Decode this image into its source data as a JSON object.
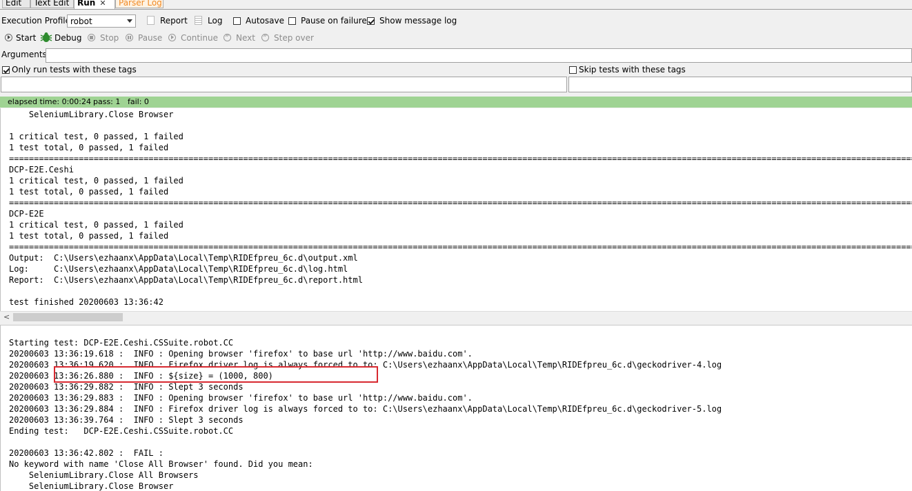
{
  "tabs": [
    {
      "label": "Edit",
      "active": false
    },
    {
      "label": "Text Edit",
      "active": false
    },
    {
      "label": "Run",
      "active": true
    },
    {
      "label": "Parser Log",
      "active": false
    }
  ],
  "tab_close": "✕",
  "profile": {
    "label": "Execution Profile:",
    "value": "robot"
  },
  "report_label": "Report",
  "log_label": "Log",
  "autosave": {
    "label": "Autosave",
    "checked": false
  },
  "pause_on_failure": {
    "label": "Pause on failure",
    "checked": false
  },
  "show_message_log": {
    "label": "Show message log",
    "checked": true
  },
  "controls": {
    "start": "Start",
    "debug": "Debug",
    "stop": "Stop",
    "pause": "Pause",
    "continue": "Continue",
    "next": "Next",
    "step_over": "Step over"
  },
  "arguments_label": "Arguments:",
  "only_run_tags": {
    "label": "Only run tests with these tags",
    "checked": true
  },
  "skip_tags": {
    "label": "Skip tests with these tags",
    "checked": false
  },
  "status": {
    "elapsed": "elapsed time: 0:00:24",
    "pass": "pass: 1",
    "fail": "fail: 0",
    "color": "#9fd393"
  },
  "output_text": "    SeleniumLibrary.Close Browser\n\n1 critical test, 0 passed, 1 failed\n1 test total, 0 passed, 1 failed\n==============================================================================================================================================================================================================\nDCP-E2E.Ceshi\n1 critical test, 0 passed, 1 failed\n1 test total, 0 passed, 1 failed\n==============================================================================================================================================================================================================\nDCP-E2E\n1 critical test, 0 passed, 1 failed\n1 test total, 0 passed, 1 failed\n==============================================================================================================================================================================================================\nOutput:  C:\\Users\\ezhaanx\\AppData\\Local\\Temp\\RIDEfpreu_6c.d\\output.xml\nLog:     C:\\Users\\ezhaanx\\AppData\\Local\\Temp\\RIDEfpreu_6c.d\\log.html\nReport:  C:\\Users\\ezhaanx\\AppData\\Local\\Temp\\RIDEfpreu_6c.d\\report.html\n\ntest finished 20200603 13:36:42",
  "message_log_text": "Starting test: DCP-E2E.Ceshi.CSSuite.robot.CC\n20200603 13:36:19.618 :  INFO : Opening browser 'firefox' to base url 'http://www.baidu.com'.\n20200603 13:36:19.620 :  INFO : Firefox driver log is always forced to to: C:\\Users\\ezhaanx\\AppData\\Local\\Temp\\RIDEfpreu_6c.d\\geckodriver-4.log\n20200603 13:36:26.880 :  INFO : ${size} = (1000, 800)\n20200603 13:36:29.882 :  INFO : Slept 3 seconds\n20200603 13:36:29.883 :  INFO : Opening browser 'firefox' to base url 'http://www.baidu.com'.\n20200603 13:36:29.884 :  INFO : Firefox driver log is always forced to to: C:\\Users\\ezhaanx\\AppData\\Local\\Temp\\RIDEfpreu_6c.d\\geckodriver-5.log\n20200603 13:36:39.764 :  INFO : Slept 3 seconds\nEnding test:   DCP-E2E.Ceshi.CSSuite.robot.CC\n\n20200603 13:36:42.802 :  FAIL :\nNo keyword with name 'Close All Browser' found. Did you mean:\n    SeleniumLibrary.Close All Browsers\n    SeleniumLibrary.Close Browser"
}
